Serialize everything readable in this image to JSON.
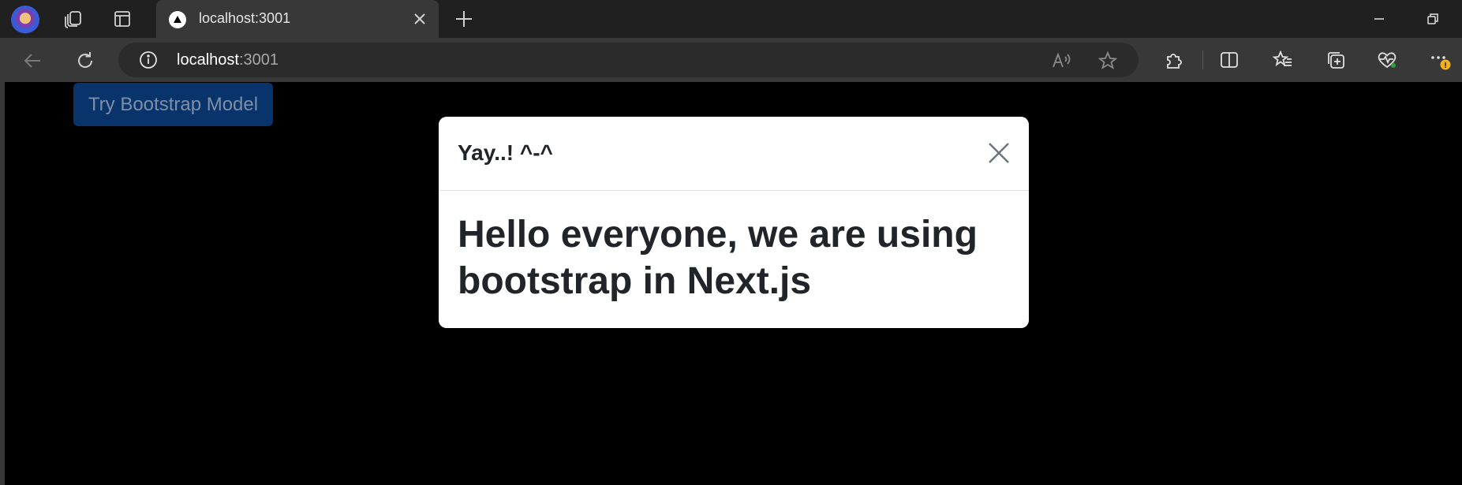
{
  "browser": {
    "tab": {
      "title": "localhost:3001"
    },
    "address": {
      "host": "localhost",
      "port": ":3001"
    },
    "update_badge": "!"
  },
  "page": {
    "try_button": "Try Bootstrap Model",
    "modal": {
      "title": "Yay..! ^-^",
      "body": "Hello everyone, we are using bootstrap in Next.js"
    }
  },
  "colors": {
    "titlebar": "#202020",
    "toolbar": "#383838",
    "button": "#08336b",
    "modal_bg": "#ffffff"
  }
}
